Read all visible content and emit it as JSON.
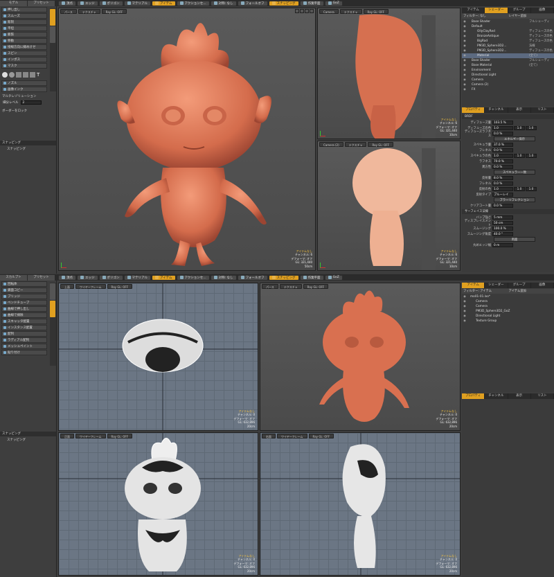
{
  "top": {
    "left_tabs": [
      "モデル",
      "プリセット"
    ],
    "mode_tabs": [
      {
        "label": "頂点"
      },
      {
        "label": "エッジ"
      },
      {
        "label": "ポリゴン"
      },
      {
        "label": "マテリアル"
      },
      {
        "label": "アイテム",
        "active": true
      },
      {
        "label": "アクションセ..."
      },
      {
        "label": "対称: なし"
      },
      {
        "label": "フォールオフ"
      },
      {
        "label": "スナッピング",
        "active": true
      },
      {
        "label": "作業平面"
      },
      {
        "label": "GoZ"
      }
    ],
    "tools": [
      "押し出し",
      "スムーズ",
      "彫刻",
      "平坦",
      "膨張",
      "移動",
      "接線方向に縁めけせ",
      "スピン",
      "インポス",
      "マスク"
    ],
    "tool_section": [
      "ノズル",
      "画像インク"
    ],
    "multires_label": "マルチレゾリューション",
    "subdiv_label": "細分レベル",
    "subdiv_value": "2",
    "border_lock": "ボーダーをロック",
    "snap_header": "スナッピング",
    "snap_item": "スナッピング",
    "viewports": [
      {
        "tabs": [
          "パース",
          "テクスチャ",
          "Ray GL: OFF"
        ],
        "info": [
          "アイテムなし",
          "チャンネル: 6",
          "デフォーマ: オフ",
          "GL: 321,440",
          "50cm"
        ]
      },
      {
        "tabs": [
          "Camera",
          "テクスチャ",
          "Ray GL: OFF"
        ],
        "info": [
          "アイテムなし",
          "チャンネル: 6",
          "デフォーマ: オフ",
          "GL: 321,440",
          "10cm"
        ]
      },
      {
        "tabs": [
          "Camera (2)",
          "テクスチャ",
          "Ray GL: OFF"
        ],
        "info": [
          "アイテムなし",
          "チャンネル: 6",
          "デフォーマ: オフ",
          "GL: 321,440",
          "10cm"
        ]
      }
    ],
    "right_tabs": [
      "アイテム",
      "シェーダー",
      "グループ",
      "画像"
    ],
    "filter": "フィルター: なし",
    "layer_filter": "レイヤー追加",
    "tree": [
      {
        "name": "Base Shader",
        "type": "フルシェーディ"
      },
      {
        "name": "Default",
        "type": ""
      },
      {
        "name": "OllyClayRed",
        "type": "ディフューズの色"
      },
      {
        "name": "BronzeAntique",
        "type": "ディフューズの色"
      },
      {
        "name": "BigRad",
        "type": "ディフューズの色"
      },
      {
        "name": "PM3D_Sphere3D2...",
        "type": "法線"
      },
      {
        "name": "PM3D_Sphere3D2...",
        "type": "ディフューズの色"
      },
      {
        "name": "Material",
        "type": "(全て)",
        "sel": true
      },
      {
        "name": "Base Shader",
        "type": "フルシェーディ"
      },
      {
        "name": "Base Material",
        "type": "(全て)"
      },
      {
        "name": "Environment",
        "type": ""
      },
      {
        "name": "Directional Light",
        "type": ""
      },
      {
        "name": "Camera",
        "type": ""
      },
      {
        "name": "Camera (2)",
        "type": ""
      },
      {
        "name": "FX",
        "type": ""
      }
    ],
    "prop_tabs": [
      "プロパティ",
      "チャンネル",
      "表示",
      "リスト"
    ],
    "props": [
      {
        "label": "ディフューズ量",
        "value": "103.5 %"
      },
      {
        "label": "ディフューズの色",
        "value": "1.0",
        "v2": "1.0",
        "v3": "1.0"
      },
      {
        "label": "ディフューズラフネス",
        "value": "0.0 %"
      }
    ],
    "energy_btn": "エネルギー保存",
    "props2": [
      {
        "label": "スペキュラ量",
        "value": "37.0 %"
      },
      {
        "label": "フレネル",
        "value": "0.0 %"
      },
      {
        "label": "スペキュラの色",
        "value": "1.0",
        "v2": "1.0",
        "v3": "1.0"
      },
      {
        "label": "ラフネス",
        "value": "70.0 %"
      },
      {
        "label": "異方性",
        "value": "0.0 %"
      }
    ],
    "specmatch_btn": "スペキュラー一致",
    "props3": [
      {
        "label": "反射量",
        "value": "8.0 %"
      },
      {
        "label": "フレネル",
        "value": "0.0 %"
      },
      {
        "label": "反射の色",
        "value": "1.0",
        "v2": "1.0",
        "v3": "1.0"
      },
      {
        "label": "反射タイプ",
        "value": "ブルーレイ"
      }
    ],
    "blur_btn": "ブラーリフレクション",
    "props4": [
      {
        "label": "クリアコート量",
        "value": "0.0 %"
      }
    ],
    "surface_sect": "サーフェイス法線",
    "props5": [
      {
        "label": "バンプ強さ",
        "value": "5 mm"
      },
      {
        "label": "ディスプレイスメント",
        "value": "50 cm"
      },
      {
        "label": "スムージング",
        "value": "100.0 %"
      },
      {
        "label": "スムージング角度",
        "value": "40.0 °"
      }
    ],
    "both_btn": "両面",
    "props6": [
      {
        "label": "丸めエッジ幅",
        "value": "0 m"
      }
    ]
  },
  "bottom": {
    "left_tabs": [
      "スカルプト",
      "プリセット"
    ],
    "mode_tabs": [
      {
        "label": "頂点"
      },
      {
        "label": "エッジ"
      },
      {
        "label": "ポリゴン"
      },
      {
        "label": "マテリアル"
      },
      {
        "label": "アイテム",
        "active": true
      },
      {
        "label": "アクションセ..."
      },
      {
        "label": "対称: なし"
      },
      {
        "label": "フォールオフ"
      },
      {
        "label": "スナッピング",
        "active": true
      },
      {
        "label": "作業平面"
      },
      {
        "label": "GoZ"
      }
    ],
    "tools": [
      "回転体",
      "鏡面コピー",
      "ブリッジ",
      "ベンドチューブ",
      "曲線で押し出し",
      "曲線で掃除",
      "スキャッタ配置",
      "インスタンス配置",
      "配列",
      "ラディアル配列",
      "メッシュペイント",
      "貼り付け"
    ],
    "snap_header": "スナッピング",
    "snap_item": "スナッピング",
    "viewports": [
      {
        "tabs": [
          "上面",
          "ワイヤーフレーム",
          "Ray GL: OFF"
        ],
        "info": [
          "アイテムなし",
          "チャンネル: 0",
          "デフォーマ: オフ",
          "GL: 632,896",
          "20cm"
        ]
      },
      {
        "tabs": [
          "パース",
          "テクスチャ",
          "Ray GL: OFF"
        ],
        "info": [
          "アイテムなし",
          "チャンネル: 0",
          "デフォーマ: オフ",
          "GL: 632,896",
          "20cm"
        ]
      },
      {
        "tabs": [
          "正面",
          "ワイヤーフレーム",
          "Ray GL: OFF"
        ],
        "info": [
          "アイテムなし",
          "チャンネル: 0",
          "デフォーマ: オフ",
          "GL: 632,896",
          "20cm"
        ]
      },
      {
        "tabs": [
          "右面",
          "ワイヤーフレーム",
          "Ray GL: OFF"
        ],
        "info": [
          "アイテムなし",
          "チャンネル: 0",
          "デフォーマ: オフ",
          "GL: 632,896",
          "20cm"
        ]
      }
    ],
    "right_tabs": [
      "アイテム",
      "シェーダー",
      "グループ",
      "画像"
    ],
    "filter": "フィルター: アイテム",
    "add_item": "アイテム追加",
    "tree": [
      {
        "name": "mo01-01.lxo*"
      },
      {
        "name": "Camera"
      },
      {
        "name": "Camera"
      },
      {
        "name": "PM3D_Sphere3D2_GoZ"
      },
      {
        "name": "Directional Light"
      },
      {
        "name": "Texture Group"
      }
    ],
    "prop_tabs": [
      "プロパティ",
      "チャンネル",
      "表示",
      "リスト"
    ]
  }
}
